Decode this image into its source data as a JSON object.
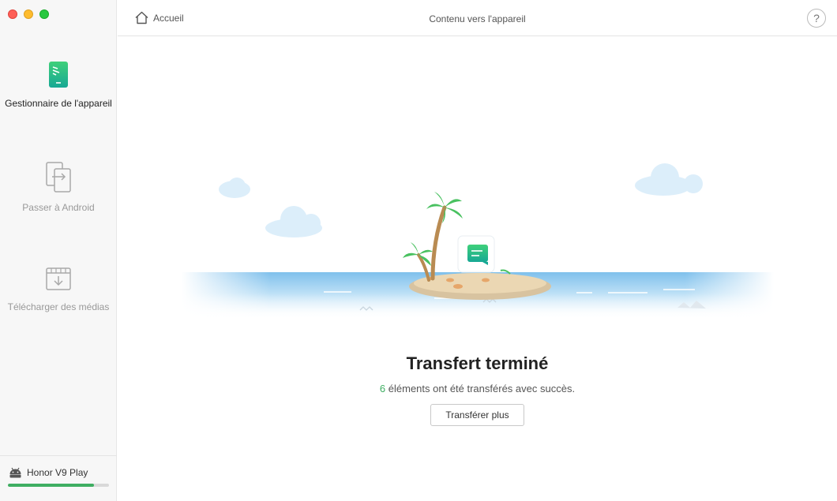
{
  "sidebar": {
    "items": [
      {
        "label": "Gestionnaire de l'appareil",
        "icon": "phone-manager-icon",
        "active": true
      },
      {
        "label": "Passer à Android",
        "icon": "switch-to-android-icon",
        "active": false
      },
      {
        "label": "Télécharger des médias",
        "icon": "download-media-icon",
        "active": false
      }
    ],
    "device": {
      "name": "Honor V9 Play",
      "icon": "android-icon",
      "storage_used_fraction": 0.85
    }
  },
  "header": {
    "home_label": "Accueil",
    "title": "Contenu vers l'appareil",
    "help_label": "?"
  },
  "main": {
    "title": "Transfert terminé",
    "count": "6",
    "message": " éléments ont été transférés avec succès.",
    "button_label": "Transférer plus"
  },
  "colors": {
    "accent": "#3fae62",
    "sidebar_bg": "#f7f7f7",
    "sea": "#8cc7ee"
  }
}
